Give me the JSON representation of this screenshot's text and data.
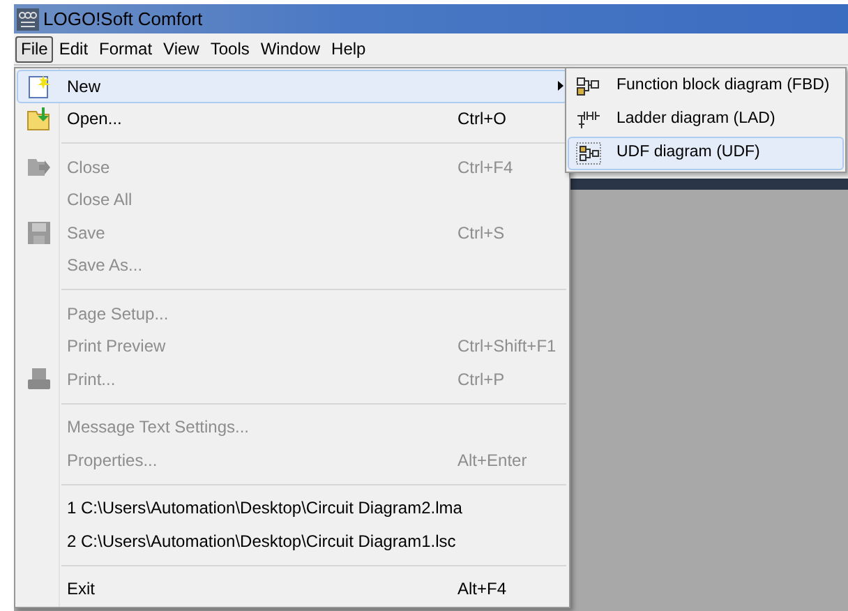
{
  "window": {
    "title": "LOGO!Soft Comfort"
  },
  "menubar": [
    {
      "label": "File",
      "selected": true
    },
    {
      "label": "Edit",
      "selected": false
    },
    {
      "label": "Format",
      "selected": false
    },
    {
      "label": "View",
      "selected": false
    },
    {
      "label": "Tools",
      "selected": false
    },
    {
      "label": "Window",
      "selected": false
    },
    {
      "label": "Help",
      "selected": false
    }
  ],
  "file_menu": [
    {
      "kind": "item",
      "label": "New",
      "disabled": false,
      "selected": true,
      "submenu": true
    },
    {
      "kind": "item",
      "label": "Open...",
      "shortcut": "Ctrl+O",
      "disabled": false,
      "selected": false
    },
    {
      "kind": "separator"
    },
    {
      "kind": "item",
      "label": "Close",
      "shortcut": "Ctrl+F4",
      "disabled": true,
      "selected": false
    },
    {
      "kind": "item",
      "label": "Close All",
      "disabled": true,
      "selected": false
    },
    {
      "kind": "item",
      "label": "Save",
      "shortcut": "Ctrl+S",
      "disabled": true,
      "selected": false
    },
    {
      "kind": "item",
      "label": "Save As...",
      "disabled": true,
      "selected": false
    },
    {
      "kind": "separator"
    },
    {
      "kind": "item",
      "label": "Page Setup...",
      "disabled": true,
      "selected": false
    },
    {
      "kind": "item",
      "label": "Print Preview",
      "shortcut": "Ctrl+Shift+F1",
      "disabled": true,
      "selected": false
    },
    {
      "kind": "item",
      "label": "Print...",
      "shortcut": "Ctrl+P",
      "disabled": true,
      "selected": false
    },
    {
      "kind": "separator"
    },
    {
      "kind": "item",
      "label": "Message Text Settings...",
      "disabled": true,
      "selected": false
    },
    {
      "kind": "item",
      "label": "Properties...",
      "shortcut": "Alt+Enter",
      "disabled": true,
      "selected": false
    },
    {
      "kind": "separator"
    },
    {
      "kind": "item",
      "label": "1 C:\\Users\\Automation\\Desktop\\Circuit Diagram2.lma",
      "disabled": false,
      "selected": false
    },
    {
      "kind": "item",
      "label": "2 C:\\Users\\Automation\\Desktop\\Circuit Diagram1.lsc",
      "disabled": false,
      "selected": false
    },
    {
      "kind": "separator"
    },
    {
      "kind": "item",
      "label": "Exit",
      "shortcut": "Alt+F4",
      "disabled": false,
      "selected": false
    }
  ],
  "new_submenu": [
    {
      "label": "Function block diagram (FBD)",
      "selected": false
    },
    {
      "label": "Ladder diagram (LAD)",
      "selected": false
    },
    {
      "label": "UDF diagram (UDF)",
      "selected": true
    }
  ]
}
